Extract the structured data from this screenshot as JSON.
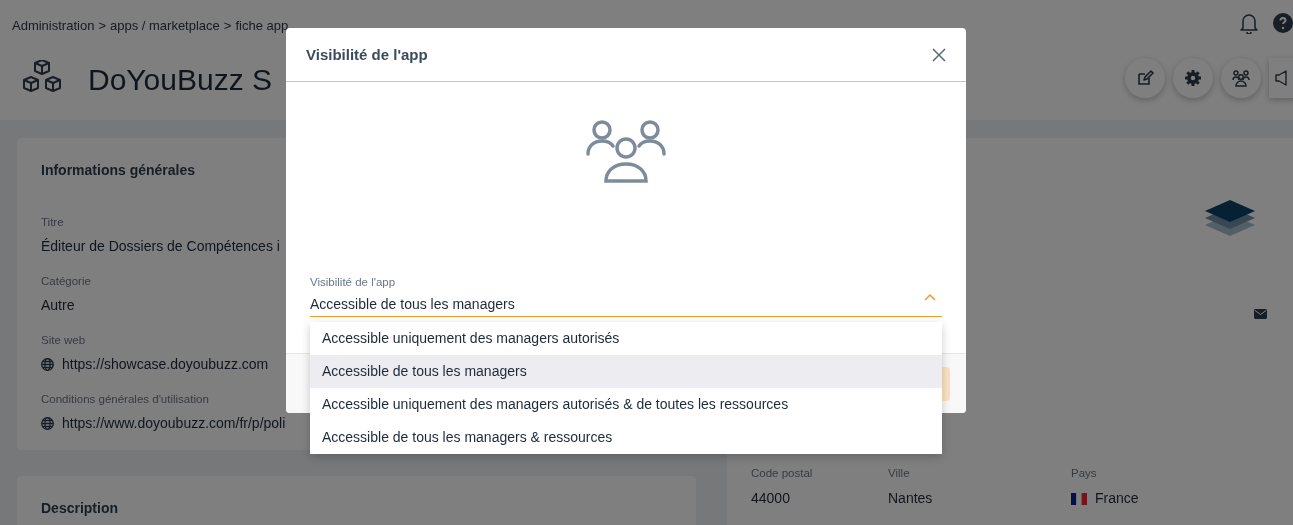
{
  "breadcrumb": {
    "separator": ">",
    "items": [
      {
        "label": "Administration"
      },
      {
        "label": "apps / marketplace"
      },
      {
        "label": "fiche app"
      }
    ]
  },
  "header": {
    "title": "DoYouBuzz S"
  },
  "general_info": {
    "title": "Informations générales",
    "fields": [
      {
        "label": "Titre",
        "value": "Éditeur de Dossiers de Compétences i",
        "kind": "text"
      },
      {
        "label": "Catégorie",
        "value": "Autre",
        "kind": "text"
      },
      {
        "label": "Site web",
        "value": "https://showcase.doyoubuzz.com",
        "kind": "link"
      },
      {
        "label": "Conditions générales d'utilisation",
        "value": "https://www.doyoubuzz.com/fr/p/poli",
        "kind": "link"
      }
    ]
  },
  "description": {
    "title": "Description"
  },
  "contact": {
    "fields": [
      {
        "label": "Code postal",
        "value": "44000",
        "kind": "text"
      },
      {
        "label": "Ville",
        "value": "Nantes",
        "kind": "text"
      },
      {
        "label": "Pays",
        "value": "France",
        "kind": "country"
      }
    ]
  },
  "modal": {
    "title": "Visibilité de l'app",
    "field": {
      "label": "Visibilité de l'app",
      "value": "Accessible de tous les managers",
      "expanded": true
    },
    "options": [
      {
        "label": "Accessible uniquement des managers autorisés",
        "selected": false
      },
      {
        "label": "Accessible de tous les managers",
        "selected": true
      },
      {
        "label": "Accessible uniquement des managers autorisés & de toutes les ressources",
        "selected": false
      },
      {
        "label": "Accessible de tous les managers & ressources",
        "selected": false
      }
    ]
  }
}
